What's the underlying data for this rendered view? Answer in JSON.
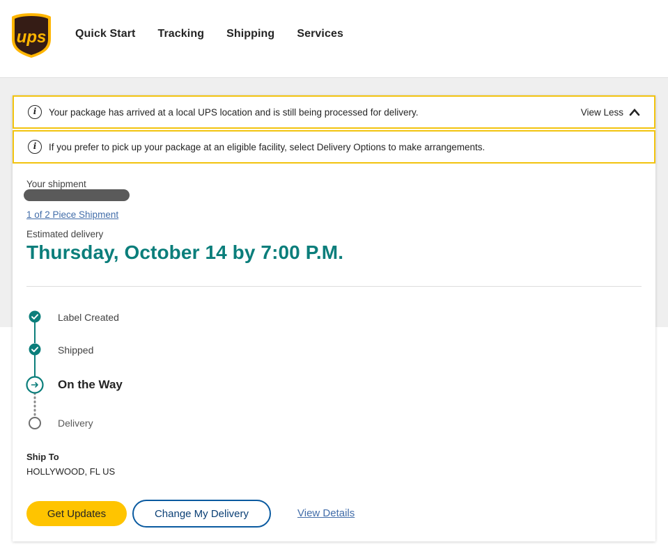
{
  "brand": {
    "logo_text": "UPS",
    "colors": {
      "brown": "#351c15",
      "gold": "#ffb500",
      "teal": "#0b7e7b",
      "alert_border": "#f2c30e",
      "link": "#426da9"
    }
  },
  "nav": {
    "items": [
      {
        "label": "Quick Start"
      },
      {
        "label": "Tracking"
      },
      {
        "label": "Shipping"
      },
      {
        "label": "Services"
      }
    ]
  },
  "alerts": {
    "processing": {
      "text": "Your package has arrived at a local UPS location and is still being processed for delivery.",
      "toggle_label": "View Less",
      "icon": "info-icon"
    },
    "pickup": {
      "text": "If you prefer to pick up your package at an eligible facility, select Delivery Options to make arrangements.",
      "icon": "info-icon"
    }
  },
  "shipment": {
    "label": "Your shipment",
    "piece_link": "1 of 2 Piece Shipment",
    "estimated_label": "Estimated delivery",
    "estimated_date": "Thursday, October 14 by 7:00 P.M."
  },
  "progress": {
    "steps": [
      {
        "label": "Label Created",
        "status": "complete",
        "icon": "check-circle-icon"
      },
      {
        "label": "Shipped",
        "status": "complete",
        "icon": "check-circle-icon"
      },
      {
        "label": "On the Way",
        "status": "current",
        "icon": "arrow-circle-icon"
      },
      {
        "label": "Delivery",
        "status": "upcoming",
        "icon": "empty-circle-icon"
      }
    ]
  },
  "ship_to": {
    "label": "Ship To",
    "value": "HOLLYWOOD, FL US"
  },
  "actions": {
    "get_updates": "Get Updates",
    "change_delivery": "Change My Delivery",
    "view_details": "View Details"
  }
}
